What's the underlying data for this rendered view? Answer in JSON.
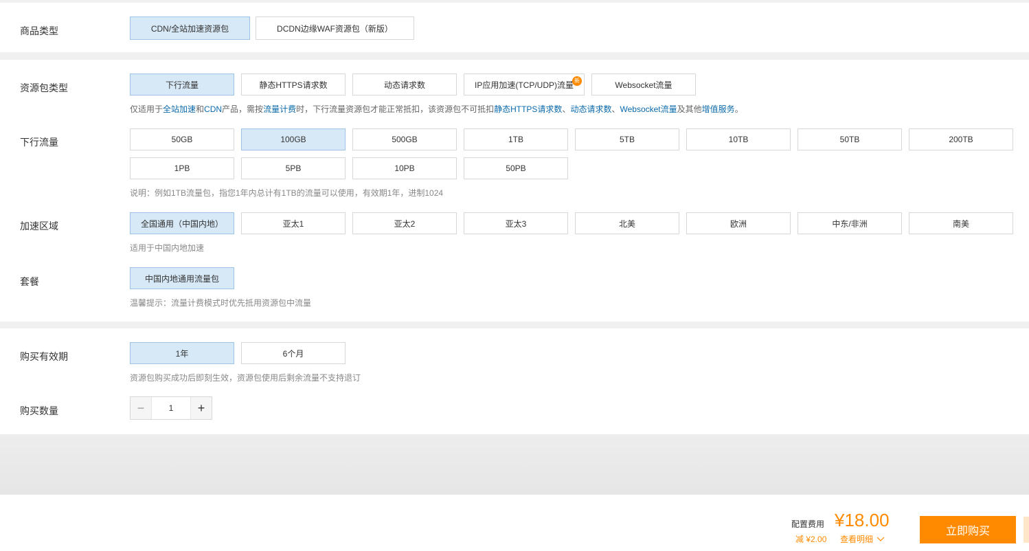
{
  "product_type": {
    "label": "商品类型",
    "options": [
      "CDN/全站加速资源包",
      "DCDN边缘WAF资源包（新版）"
    ]
  },
  "package_type": {
    "label": "资源包类型",
    "options": [
      "下行流量",
      "静态HTTPS请求数",
      "动态请求数",
      "IP应用加速(TCP/UDP)流量",
      "Websocket流量"
    ],
    "new_badge": "新",
    "note": {
      "p1": "仅适用于",
      "l1": "全站加速",
      "p2": "和",
      "l2": "CDN",
      "p3": "产品，需按",
      "l3": "流量计费",
      "p4": "时，下行流量资源包才能正常抵扣，该资源包不可抵扣",
      "l4": "静态HTTPS请求数",
      "p5": "、",
      "l5": "动态请求数",
      "p6": "、",
      "l6": "Websocket流量",
      "p7": "及其他",
      "l7": "增值服务",
      "p8": "。"
    }
  },
  "traffic": {
    "label": "下行流量",
    "options": [
      "50GB",
      "100GB",
      "500GB",
      "1TB",
      "5TB",
      "10TB",
      "50TB",
      "200TB",
      "1PB",
      "5PB",
      "10PB",
      "50PB"
    ],
    "note": "说明：例如1TB流量包，指您1年内总计有1TB的流量可以使用，有效期1年，进制1024"
  },
  "region": {
    "label": "加速区域",
    "options": [
      "全国通用（中国内地）",
      "亚太1",
      "亚太2",
      "亚太3",
      "北美",
      "欧洲",
      "中东/非洲",
      "南美"
    ],
    "note": "适用于中国内地加速"
  },
  "plan": {
    "label": "套餐",
    "options": [
      "中国内地通用流量包"
    ],
    "note": "温馨提示：流量计费模式时优先抵用资源包中流量"
  },
  "validity": {
    "label": "购买有效期",
    "options": [
      "1年",
      "6个月"
    ],
    "note": "资源包购买成功后即刻生效，资源包使用后剩余流量不支持退订"
  },
  "quantity": {
    "label": "购买数量",
    "value": "1",
    "minus": "−",
    "plus": "+"
  },
  "footer": {
    "cost_label": "配置费用",
    "price": "¥18.00",
    "discount": "减 ¥2.00",
    "detail_link": "查看明细",
    "buy_button": "立即购买"
  },
  "colors": {
    "accent": "#ff8a00",
    "selected_bg": "#d7e8f6",
    "link": "#0b6aab"
  }
}
